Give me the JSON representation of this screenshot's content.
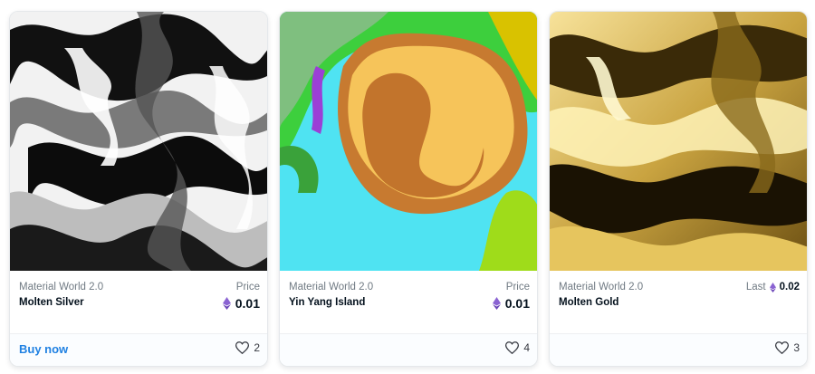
{
  "cards": [
    {
      "art": "molten-silver-artwork",
      "collection": "Material World 2.0",
      "name": "Molten Silver",
      "price_label": "Price",
      "price": "0.01",
      "buy_label": "Buy now",
      "favorites": "2"
    },
    {
      "art": "yin-yang-island-artwork",
      "collection": "Material World 2.0",
      "name": "Yin Yang Island",
      "price_label": "Price",
      "price": "0.01",
      "favorites": "4"
    },
    {
      "art": "molten-gold-artwork",
      "collection": "Material World 2.0",
      "name": "Molten Gold",
      "last_label": "Last",
      "last_price": "0.02",
      "favorites": "3"
    }
  ],
  "colors": {
    "accent": "#2081e2",
    "eth": "#8a63d2",
    "muted": "#707a83"
  },
  "icons": [
    "eth-icon",
    "heart-icon"
  ]
}
